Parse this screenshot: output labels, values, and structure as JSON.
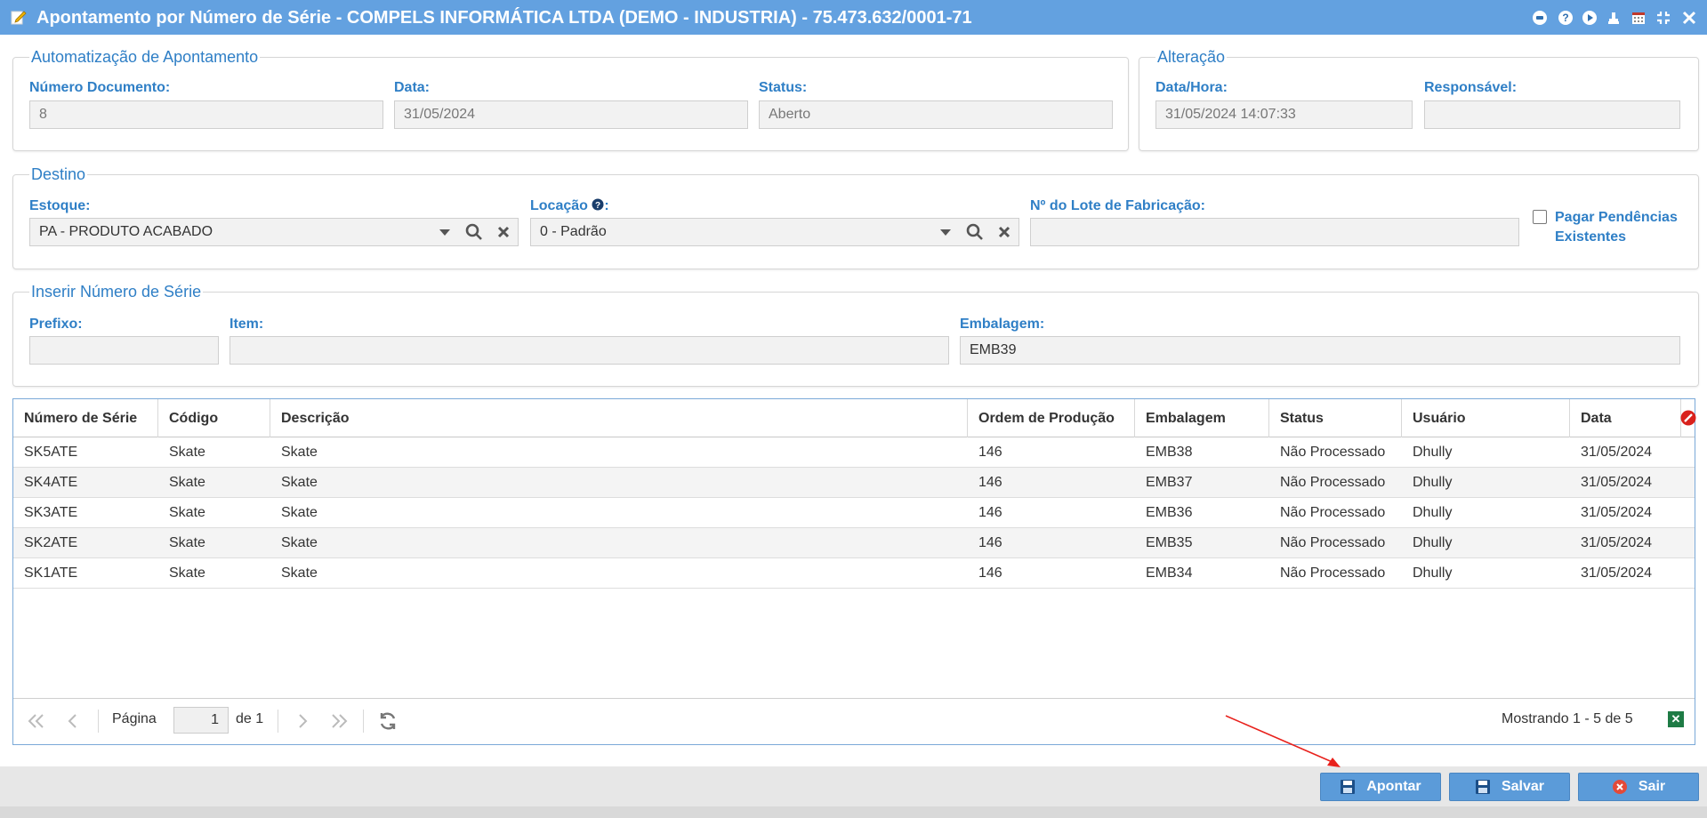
{
  "window": {
    "title": "Apontamento por Número de Série - COMPELS INFORMÁTICA LTDA (DEMO - INDUSTRIA) - 75.473.632/0001-71"
  },
  "automatizacao": {
    "legend": "Automatização de Apontamento",
    "numero_label": "Número Documento:",
    "numero_value": "8",
    "data_label": "Data:",
    "data_value": "31/05/2024",
    "status_label": "Status:",
    "status_value": "Aberto"
  },
  "alteracao": {
    "legend": "Alteração",
    "datahora_label": "Data/Hora:",
    "datahora_value": "31/05/2024 14:07:33",
    "responsavel_label": "Responsável:",
    "responsavel_value": ""
  },
  "destino": {
    "legend": "Destino",
    "estoque_label": "Estoque:",
    "estoque_value": "PA - PRODUTO ACABADO",
    "locacao_label": "Locação",
    "locacao_suffix": ":",
    "locacao_value": "0 - Padrão",
    "lote_label": "Nº do Lote de Fabricação:",
    "lote_value": "",
    "pagar_label_1": "Pagar Pendências",
    "pagar_label_2": "Existentes",
    "pagar_checked": false
  },
  "inserir": {
    "legend": "Inserir Número de Série",
    "prefixo_label": "Prefixo:",
    "prefixo_value": "",
    "item_label": "Item:",
    "item_value": "",
    "embalagem_label": "Embalagem:",
    "embalagem_value": "EMB39"
  },
  "grid": {
    "headers": [
      "Número de Série",
      "Código",
      "Descrição",
      "Ordem de Produção",
      "Embalagem",
      "Status",
      "Usuário",
      "Data"
    ],
    "rows": [
      [
        "SK5ATE",
        "Skate",
        "Skate",
        "146",
        "EMB38",
        "Não Processado",
        "Dhully",
        "31/05/2024"
      ],
      [
        "SK4ATE",
        "Skate",
        "Skate",
        "146",
        "EMB37",
        "Não Processado",
        "Dhully",
        "31/05/2024"
      ],
      [
        "SK3ATE",
        "Skate",
        "Skate",
        "146",
        "EMB36",
        "Não Processado",
        "Dhully",
        "31/05/2024"
      ],
      [
        "SK2ATE",
        "Skate",
        "Skate",
        "146",
        "EMB35",
        "Não Processado",
        "Dhully",
        "31/05/2024"
      ],
      [
        "SK1ATE",
        "Skate",
        "Skate",
        "146",
        "EMB34",
        "Não Processado",
        "Dhully",
        "31/05/2024"
      ]
    ]
  },
  "pager": {
    "page_label": "Página",
    "page_value": "1",
    "of_label": "de 1",
    "showing": "Mostrando 1 - 5 de 5"
  },
  "buttons": {
    "apontar": "Apontar",
    "salvar": "Salvar",
    "sair": "Sair"
  },
  "colors": {
    "titlebar": "#63a1e0",
    "label_blue": "#2f7fc6",
    "button_blue": "#5b9bd9",
    "annotation_red": "#e8211c"
  }
}
